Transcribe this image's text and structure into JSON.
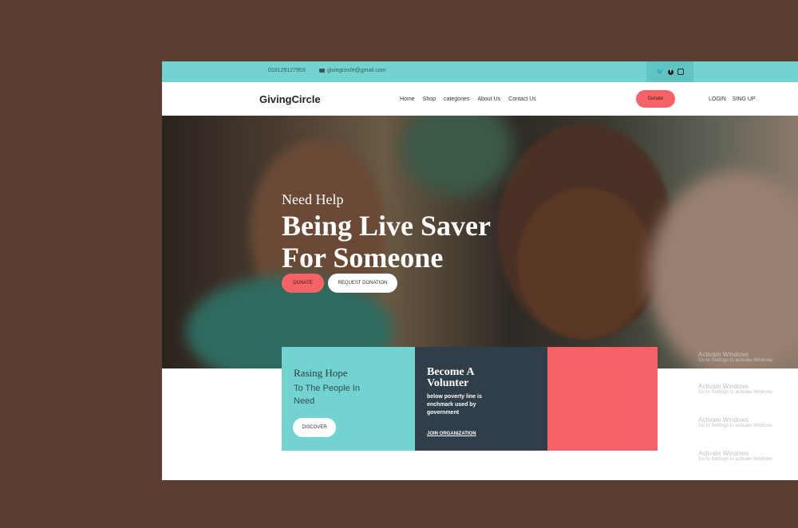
{
  "topbar": {
    "phone": "010129127959",
    "email": "givingcircle@gmail.com"
  },
  "social": [
    "twitter-icon",
    "facebook-icon",
    "instagram-icon"
  ],
  "nav": {
    "logo": "GivingCircle",
    "menu": [
      "Home",
      "Shop",
      "categories",
      "About Us",
      "Contact Us"
    ],
    "donate": "Donate",
    "login": "LOGIN",
    "signup": "SING UP"
  },
  "hero": {
    "subtitle": "Need Help",
    "title_line1": "Being Live Saver",
    "title_line2": "For Someone",
    "donate_button": "DONATE",
    "request_button": "REQUEST DONATION"
  },
  "cards": {
    "hope": {
      "title": "Rasing Hope",
      "subtitle": "To The People In Need",
      "button": "DISCOVER"
    },
    "volunteer": {
      "title": "Become A Volunter",
      "text": "below poverty line is enchmark used by government",
      "link": "JOIN ORGANIZATION"
    }
  },
  "watermarks": [
    {
      "title": "Activate Windows",
      "sub": "Go to Settings to activate Windows."
    },
    {
      "title": "Activate Windows",
      "sub": "Go to Settings to activate Windows."
    },
    {
      "title": "Activate Windows",
      "sub": "Go to Settings to activate Windows."
    },
    {
      "title": "Activate Windows",
      "sub": "Go to Settings to activate Windows."
    }
  ],
  "colors": {
    "teal": "#72d3d0",
    "coral": "#f66265",
    "navy": "#2f3e48",
    "outer_background": "#5b3d32"
  }
}
